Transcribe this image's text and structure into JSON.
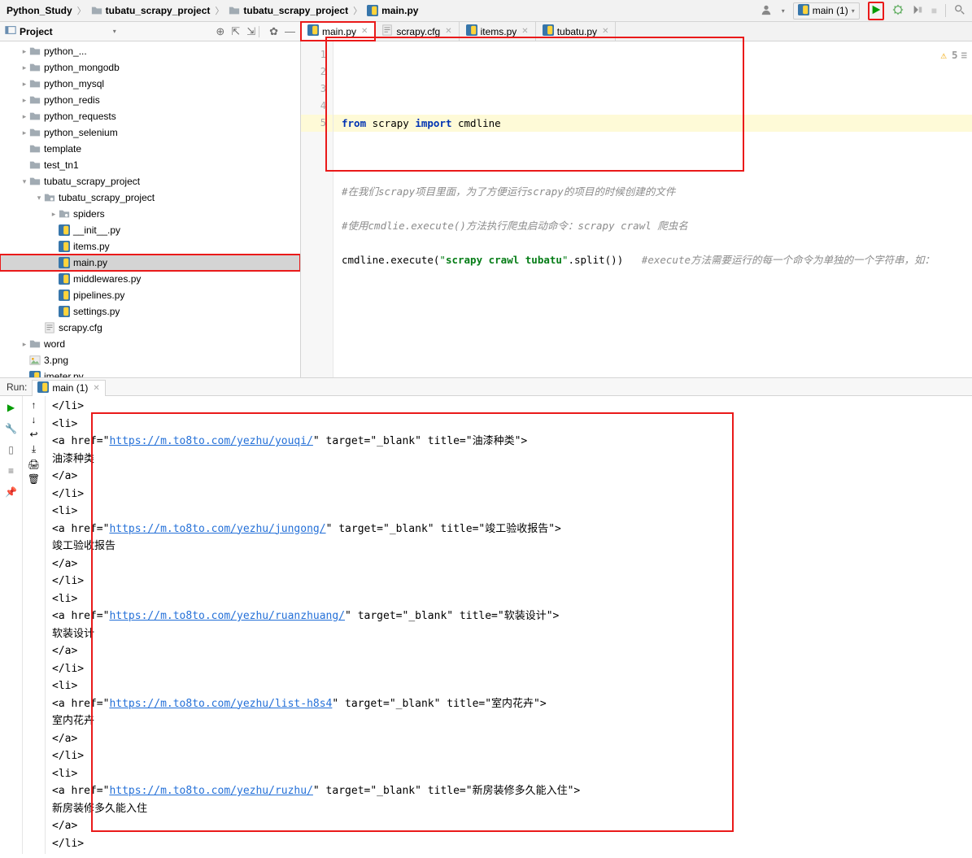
{
  "breadcrumb": {
    "root": "Python_Study",
    "p1": "tubatu_scrapy_project",
    "p2": "tubatu_scrapy_project",
    "file": "main.py"
  },
  "toolbar": {
    "config": "main (1)",
    "configDropdown": "▾"
  },
  "projectPanel": {
    "title": "Project"
  },
  "tree": [
    {
      "depth": 1,
      "tw": "▸",
      "type": "dir",
      "label": "python_..."
    },
    {
      "depth": 1,
      "tw": "▸",
      "type": "dir",
      "label": "python_mongodb"
    },
    {
      "depth": 1,
      "tw": "▸",
      "type": "dir",
      "label": "python_mysql"
    },
    {
      "depth": 1,
      "tw": "▸",
      "type": "dir",
      "label": "python_redis"
    },
    {
      "depth": 1,
      "tw": "▸",
      "type": "dir",
      "label": "python_requests"
    },
    {
      "depth": 1,
      "tw": "▸",
      "type": "dir",
      "label": "python_selenium"
    },
    {
      "depth": 1,
      "tw": "",
      "type": "dir",
      "label": "template"
    },
    {
      "depth": 1,
      "tw": "",
      "type": "dir",
      "label": "test_tn1"
    },
    {
      "depth": 1,
      "tw": "▾",
      "type": "dir",
      "label": "tubatu_scrapy_project"
    },
    {
      "depth": 2,
      "tw": "▾",
      "type": "pkg",
      "label": "tubatu_scrapy_project"
    },
    {
      "depth": 3,
      "tw": "▸",
      "type": "pkg",
      "label": "spiders"
    },
    {
      "depth": 3,
      "tw": "",
      "type": "py",
      "label": "__init__.py"
    },
    {
      "depth": 3,
      "tw": "",
      "type": "py",
      "label": "items.py"
    },
    {
      "depth": 3,
      "tw": "",
      "type": "py",
      "label": "main.py",
      "sel": true,
      "red": true
    },
    {
      "depth": 3,
      "tw": "",
      "type": "py",
      "label": "middlewares.py"
    },
    {
      "depth": 3,
      "tw": "",
      "type": "py",
      "label": "pipelines.py"
    },
    {
      "depth": 3,
      "tw": "",
      "type": "py",
      "label": "settings.py"
    },
    {
      "depth": 2,
      "tw": "",
      "type": "cfg",
      "label": "scrapy.cfg"
    },
    {
      "depth": 1,
      "tw": "▸",
      "type": "dir",
      "label": "word"
    },
    {
      "depth": 1,
      "tw": "",
      "type": "img",
      "label": "3.png"
    },
    {
      "depth": 1,
      "tw": "",
      "type": "py",
      "label": "jmeter.py"
    }
  ],
  "tabs": [
    {
      "label": "main.py",
      "type": "py",
      "active": true,
      "red": true
    },
    {
      "label": "scrapy.cfg",
      "type": "cfg"
    },
    {
      "label": "items.py",
      "type": "py"
    },
    {
      "label": "tubatu.py",
      "type": "py"
    }
  ],
  "code": {
    "l1a": "from",
    "l1b": " scrapy ",
    "l1c": "import",
    "l1d": " cmdline",
    "l3c": "#在我们scrapy项目里面，为了方便运行scrapy的项目的时候创建的文件",
    "l4c": "#使用cmdlie.execute()方法执行爬虫启动命令：scrapy crawl 爬虫名",
    "l5a": "cmdline.execute(",
    "l5b": "\"",
    "l5c": "scrapy crawl tubatu",
    "l5d": "\"",
    "l5e": ".split())   ",
    "l5f": "#execute方法需要运行的每一个命令为单独的一个字符串，如："
  },
  "inspect": {
    "warn": "⚠",
    "count": "5",
    "menu": "≡"
  },
  "lineNumbers": [
    "1",
    "2",
    "3",
    "4",
    "5"
  ],
  "run": {
    "label": "Run:",
    "tabName": "main (1)",
    "lines": [
      "</li>",
      "<div class=\"box-red\" style=\"left:56px;top:20px;width:790px;height:516px;\"></div>",
      "<li>",
      "<a href=\"<a>https://m.to8to.com/yezhu/youqi/</a>\" target=\"_blank\" title=\"油漆种类\">",
      "油漆种类",
      "</a>",
      "</li>",
      "<li>",
      "<a href=\"<a>https://m.to8to.com/yezhu/jungong/</a>\" target=\"_blank\" title=\"竣工验收报告\">",
      "竣工验收报告",
      "</a>",
      "</li>",
      "<li>",
      "<a href=\"<a>https://m.to8to.com/yezhu/ruanzhuang/</a>\" target=\"_blank\" title=\"软装设计\">",
      "软装设计",
      "</a>",
      "</li>",
      "<li>",
      "<a href=\"<a>https://m.to8to.com/yezhu/list-h8s4</a>\" target=\"_blank\" title=\"室内花卉\">",
      "室内花卉",
      "</a>",
      "</li>",
      "<li>",
      "<a href=\"<a>https://m.to8to.com/yezhu/ruzhu/</a>\" target=\"_blank\" title=\"新房装修多久能入住\">",
      "新房装修多久能入住",
      "</a>",
      "</li>"
    ]
  }
}
